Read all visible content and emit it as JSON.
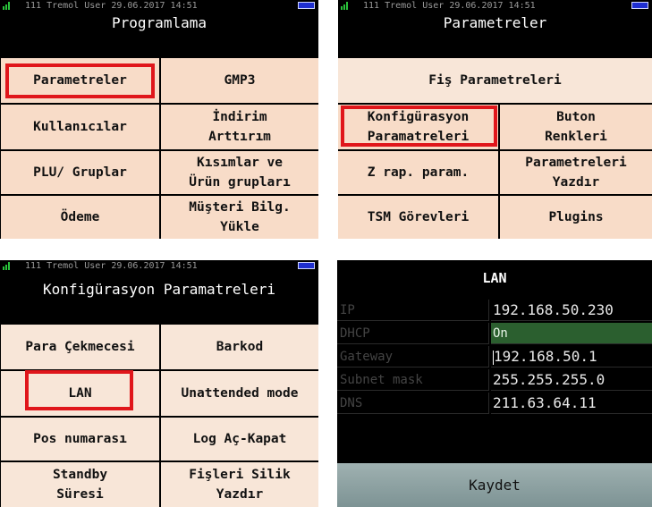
{
  "status_bar": {
    "text": "111 Tremol User  29.06.2017 14:51"
  },
  "panel1": {
    "title": "Programlama",
    "buttons": [
      "Parametreler",
      "GMP3",
      "Kullanıcılar",
      "İndirim\nArttırım",
      "PLU/ Gruplar",
      "Kısımlar ve\nÜrün grupları",
      "Ödeme",
      "Müşteri Bilg.\nYükle"
    ],
    "highlighted": "Parametreler"
  },
  "panel2": {
    "title": "Parametreler",
    "top_button": "Fiş Parametreleri",
    "buttons": [
      "Konfigürasyon\nParamatreleri",
      "Buton\nRenkleri",
      "Z rap. param.",
      "Parametreleri\nYazdır",
      "TSM Görevleri",
      "Plugins"
    ],
    "highlighted": "Konfigürasyon Paramatreleri"
  },
  "panel3": {
    "title": "Konfigürasyon Paramatreleri",
    "buttons": [
      "Para Çekmecesi",
      "Barkod",
      "LAN",
      "Unattended mode",
      "Pos numarası",
      "Log Aç-Kapat",
      "Standby\nSüresi",
      "Fişleri Silik\nYazdır"
    ],
    "highlighted": "LAN"
  },
  "lan": {
    "title": "LAN",
    "fields": [
      {
        "label": "IP",
        "value": "192.168.50.230"
      },
      {
        "label": "DHCP",
        "value": "On"
      },
      {
        "label": "Gateway",
        "value": "192.168.50.1"
      },
      {
        "label": "Subnet mask",
        "value": "255.255.255.0"
      },
      {
        "label": "DNS",
        "value": "211.63.64.11"
      }
    ],
    "save_label": "Kaydet"
  },
  "colors": {
    "button_fill": "#f8dcc8",
    "highlight": "#e0161b",
    "dhcp_on": "#2b5f2f",
    "save_bar": "#8fa3a4"
  }
}
